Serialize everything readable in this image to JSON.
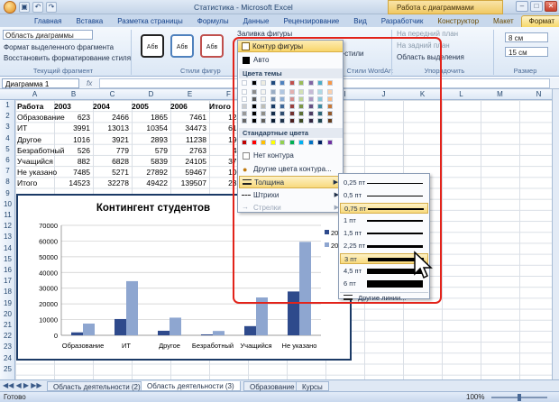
{
  "window": {
    "title": "Статистика - Microsoft Excel",
    "contextual_group": "Работа с диаграммами"
  },
  "ribbon_tabs": [
    "Главная",
    "Вставка",
    "Разметка страницы",
    "Формулы",
    "Данные",
    "Рецензирование",
    "Вид",
    "Разработчик",
    "Конструктор",
    "Макет",
    "Формат"
  ],
  "ribbon": {
    "selector_value": "Область диаграммы",
    "format_selection": "Формат выделенного фрагмента",
    "reset_style": "Восстановить форматирование стиля",
    "group_current": "Текущий фрагмент",
    "style_sample": "Абв",
    "group_shape_styles": "Стили фигур",
    "shape_fill": "Заливка фигуры",
    "shape_outline": "Контур фигуры",
    "wordart_styles": "Экспресс-стили",
    "group_wordart": "Стили WordArt",
    "bring_front": "На передний план",
    "send_back": "На задний план",
    "selection_pane": "Область выделения",
    "group_arrange": "Упорядочить",
    "height": "8 см",
    "width": "15 см",
    "group_size": "Размер"
  },
  "formula_bar": {
    "name_box": "Диаграмма 1"
  },
  "columns": [
    "A",
    "B",
    "C",
    "D",
    "E",
    "F",
    "G",
    "H",
    "I",
    "J",
    "K",
    "L",
    "M",
    "N"
  ],
  "rows": [
    "1",
    "2",
    "3",
    "4",
    "5",
    "6",
    "7",
    "8",
    "9",
    "10",
    "11",
    "12",
    "13",
    "14",
    "15",
    "16",
    "17",
    "18",
    "19",
    "20",
    "21",
    "22",
    "23",
    "24",
    "25"
  ],
  "table": {
    "header": [
      "Работа",
      "2003",
      "2004",
      "2005",
      "2006",
      "Итого"
    ],
    "rows": [
      [
        "Образование",
        "623",
        "2466",
        "1865",
        "7461",
        "1241"
      ],
      [
        "ИТ",
        "3991",
        "13013",
        "10354",
        "34473",
        "6183"
      ],
      [
        "Другое",
        "1016",
        "3921",
        "2893",
        "11238",
        "1906"
      ],
      [
        "Безработный",
        "526",
        "779",
        "579",
        "2763",
        "464"
      ],
      [
        "Учащийся",
        "882",
        "6828",
        "5839",
        "24105",
        "3765"
      ],
      [
        "Не указано",
        "7485",
        "5271",
        "27892",
        "59467",
        "1001"
      ],
      [
        "Итого",
        "14523",
        "32278",
        "49422",
        "139507",
        "2357"
      ]
    ]
  },
  "chart_data": {
    "type": "bar",
    "title": "Контингент студентов",
    "categories": [
      "Образование",
      "ИТ",
      "Другое",
      "Безработный",
      "Учащийся",
      "Не указано"
    ],
    "series": [
      {
        "name": "2005",
        "values": [
          1865,
          10354,
          2893,
          579,
          5839,
          27892
        ],
        "color": "#2e4a8c"
      },
      {
        "name": "2006",
        "values": [
          7461,
          34473,
          11238,
          2763,
          24105,
          59467
        ],
        "color": "#8ea6d0"
      }
    ],
    "ylim": [
      0,
      70000
    ],
    "yticks": [
      "0",
      "10000",
      "20000",
      "30000",
      "40000",
      "50000",
      "60000",
      "70000"
    ],
    "legend_labels": [
      "200",
      "200"
    ],
    "legend": "right",
    "grid": true
  },
  "outline_menu": {
    "header": "Контур фигуры",
    "auto": "Авто",
    "theme_colors": "Цвета темы",
    "standard_colors": "Стандартные цвета",
    "no_outline": "Нет контура",
    "more_colors": "Другие цвета контура...",
    "weight": "Толщина",
    "dashes": "Штрихи",
    "arrows": "Стрелки"
  },
  "theme_colors": [
    "#ffffff",
    "#000000",
    "#eeece1",
    "#1f497d",
    "#4f81bd",
    "#c0504d",
    "#9bbb59",
    "#8064a2",
    "#4bacc6",
    "#f79646"
  ],
  "standard_colors": [
    "#c00000",
    "#ff0000",
    "#ffc000",
    "#ffff00",
    "#92d050",
    "#00b050",
    "#00b0f0",
    "#0070c0",
    "#002060",
    "#7030a0"
  ],
  "weight_menu": {
    "items": [
      "0,25 пт",
      "0,5 пт",
      "0,75 пт",
      "1 пт",
      "1,5 пт",
      "2,25 пт",
      "3 пт",
      "4,5 пт",
      "6 пт"
    ],
    "line_widths": [
      0.5,
      1,
      1.5,
      1.5,
      2,
      3,
      4,
      6,
      8
    ],
    "more": "Другие линии..."
  },
  "sheet_tabs": [
    "Область деятельности (2)",
    "Область деятельности (3)",
    "Образование",
    "Курсы"
  ],
  "status": {
    "ready": "Готово",
    "zoom": "100%"
  }
}
